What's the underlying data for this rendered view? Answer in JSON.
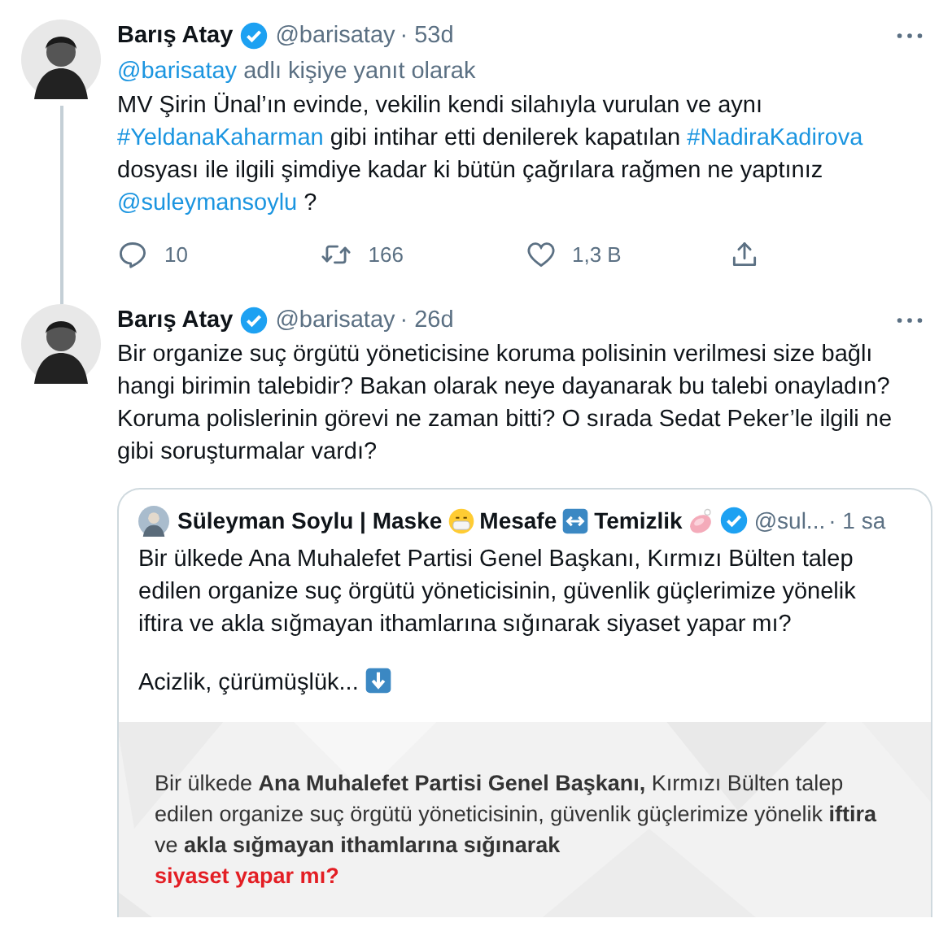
{
  "tweets": [
    {
      "name": "Barış Atay",
      "verified": true,
      "handle": "@barisatay",
      "time": "· 53d",
      "thread_line": true,
      "reply_to": [
        {
          "kind": "link",
          "text": "@barisatay"
        },
        {
          "kind": "text",
          "text": " adlı kişiye yanıt olarak"
        }
      ],
      "body": [
        {
          "kind": "text",
          "text": "MV Şirin Ünal’ın evinde, vekilin kendi silahıyla vurulan ve aynı "
        },
        {
          "kind": "link",
          "text": "#YeldanaKaharman"
        },
        {
          "kind": "text",
          "text": " gibi intihar etti denilerek kapatılan "
        },
        {
          "kind": "link",
          "text": "#NadiraKadirova"
        },
        {
          "kind": "text",
          "text": " dosyası ile ilgili şimdiye kadar ki bütün çağrılara rağmen ne yaptınız "
        },
        {
          "kind": "link",
          "text": "@suleymansoylu"
        },
        {
          "kind": "text",
          "text": " ?"
        }
      ],
      "actions": [
        {
          "kind": "reply",
          "count": "10"
        },
        {
          "kind": "retweet",
          "count": "166"
        },
        {
          "kind": "like",
          "count": "1,3 B"
        },
        {
          "kind": "share"
        }
      ]
    },
    {
      "name": "Barış Atay",
      "verified": true,
      "handle": "@barisatay",
      "time": "· 26d",
      "thread_line": false,
      "body": [
        {
          "kind": "text",
          "text": "Bir organize suç örgütü yöneticisine koruma polisinin verilmesi size bağlı hangi birimin talebidir? Bakan olarak neye dayanarak bu talebi onayladın? Koruma polislerinin görevi ne zaman bitti? O sırada Sedat Peker’le ilgili ne gibi soruşturmalar vardı?"
        }
      ],
      "quote": {
        "name_parts": [
          {
            "kind": "text",
            "text": "Süleyman Soylu | Maske"
          },
          {
            "kind": "mask"
          },
          {
            "kind": "text",
            "text": " Mesafe"
          },
          {
            "kind": "arrows"
          },
          {
            "kind": "text",
            "text": " Temizlik"
          },
          {
            "kind": "soap"
          }
        ],
        "verified": true,
        "handle": "@sul...",
        "time": "· 1 sa",
        "paragraphs": [
          "Bir ülkede Ana Muhalefet Partisi Genel Başkanı, Kırmızı Bülten talep edilen organize suç örgütü yöneticisinin, güvenlik güçlerimize yönelik iftira ve akla sığmayan ithamlarına sığınarak siyaset yapar mı?",
          "Acizlik, çürümüşlük..."
        ],
        "image": {
          "kind": "picture",
          "caption": "Bir ülkede **Ana Muhalefet Partisi Genel Başkanı,** Kırmızı Bülten talep edilen organize suç örgütü yöneticisinin, güvenlik güçlerimize yönelik **iftira** ve **akla sığmayan ithamlarına sığınarak**",
          "highlight": "siyaset yapar mı?"
        }
      }
    }
  ]
}
